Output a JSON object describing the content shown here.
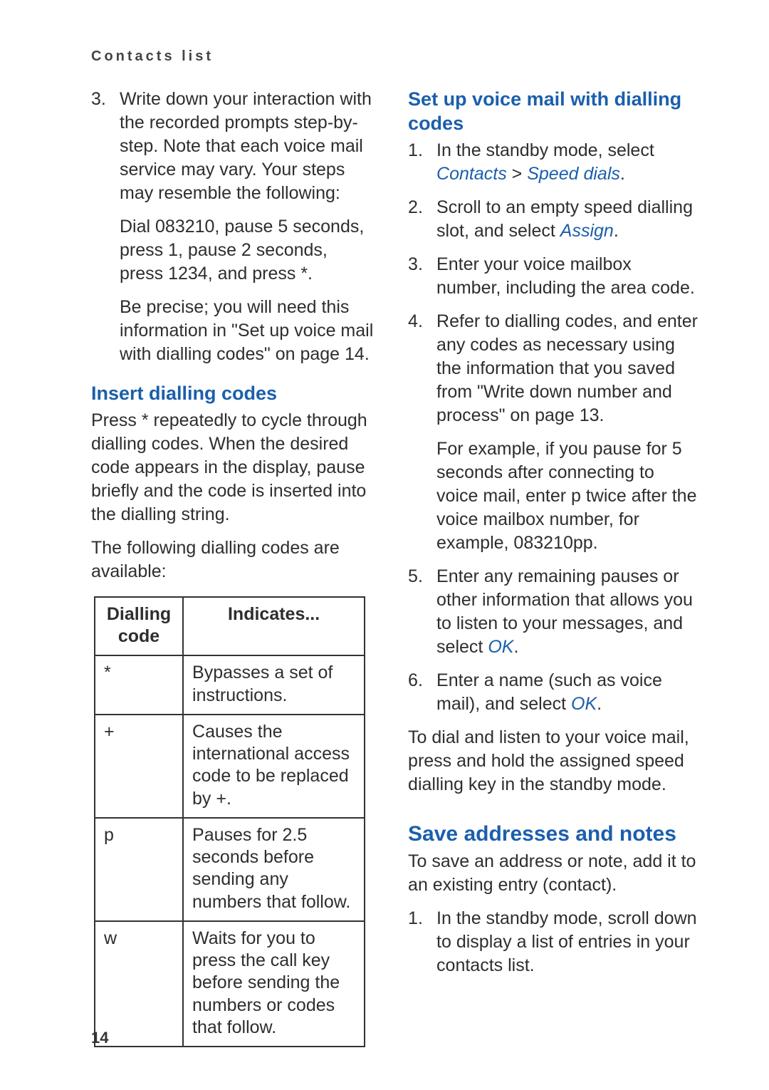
{
  "header": {
    "title": "Contacts list"
  },
  "page_number": "14",
  "left": {
    "continued_list": [
      {
        "text": "Write down your interaction with the recorded prompts step-by-step. Note that each voice mail service may vary. Your steps may resemble the following:",
        "sub": [
          "Dial 083210, pause 5 seconds, press 1, pause 2 seconds, press 1234, and press *.",
          "Be precise; you will need this information in \"Set up voice mail with dialling codes\" on page 14."
        ]
      }
    ],
    "insert_heading": "Insert dialling codes",
    "insert_p1": "Press * repeatedly to cycle through dialling codes. When the desired code appears in the display, pause briefly and the code is inserted into the dialling string.",
    "insert_p2": "The following dialling codes are available:",
    "table": {
      "headers": [
        "Dialling code",
        "Indicates..."
      ],
      "rows": [
        [
          "*",
          "Bypasses a set of instructions."
        ],
        [
          "+",
          "Causes the international access code to be replaced by +."
        ],
        [
          "p",
          "Pauses for 2.5 seconds before sending any numbers that follow."
        ],
        [
          "w",
          "Waits for you to press the call key before sending the numbers or codes that follow."
        ]
      ]
    }
  },
  "right": {
    "setup_heading": "Set up voice mail with dialling codes",
    "menu_contacts": "Contacts",
    "menu_speed_dials": "Speed dials",
    "menu_assign": "Assign",
    "menu_ok": "OK",
    "steps": {
      "s1_pre": "In the standby mode, select ",
      "s1_sep": " > ",
      "s1_post": ".",
      "s2_pre": "Scroll to an empty speed dialling slot, and select ",
      "s2_post": ".",
      "s3": "Enter your voice mailbox number, including the area code.",
      "s4_main": "Refer to dialling codes, and enter any codes as necessary using the information that you saved from \"Write down number and process\" on page 13.",
      "s4_sub": "For example, if you pause for 5 seconds after connecting to voice mail, enter p twice after the voice mailbox number, for example, 083210pp.",
      "s5_pre": "Enter any remaining pauses or other information that allows you to listen to your messages, and select ",
      "s5_post": ".",
      "s6_pre": "Enter a name (such as voice mail), and select ",
      "s6_post": "."
    },
    "setup_outro": "To dial and listen to your voice mail, press and hold the assigned speed dialling key in the standby mode.",
    "save_heading": "Save addresses and notes",
    "save_intro": "To save an address or note, add it to an existing entry (contact).",
    "save_steps": {
      "s1": "In the standby mode, scroll down to display a list of entries in your contacts list."
    }
  }
}
